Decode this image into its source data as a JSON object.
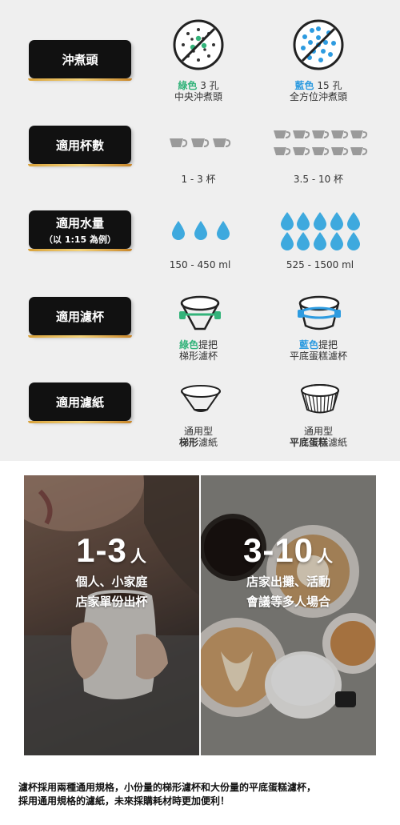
{
  "rows": {
    "brew_head": {
      "label": "沖煮頭",
      "left": {
        "color_word": "綠色",
        "count_text": " 3 孔",
        "desc": "中央沖煮頭"
      },
      "right": {
        "color_word": "藍色",
        "count_text": " 15 孔",
        "desc": "全方位沖煮頭"
      }
    },
    "cups": {
      "label": "適用杯數",
      "left": {
        "range": "1 - 3 杯",
        "cup_count": 3
      },
      "right": {
        "range": "3.5 - 10 杯",
        "cup_count": 10
      }
    },
    "water": {
      "label": "適用水量",
      "label_sub": "（以 1:15 為例）",
      "left": {
        "range": "150 - 450 ml",
        "drop_count": 3
      },
      "right": {
        "range": "525 - 1500 ml",
        "drop_count": 10
      }
    },
    "dripper": {
      "label": "適用濾杯",
      "left": {
        "color_word": "綠色",
        "suffix": "提把",
        "desc": "梯形濾杯"
      },
      "right": {
        "color_word": "藍色",
        "suffix": "提把",
        "desc": "平底蛋糕濾杯"
      }
    },
    "paper": {
      "label": "適用濾紙",
      "left": {
        "line1": "通用型",
        "bold": "梯形",
        "suffix": "濾紙"
      },
      "right": {
        "line1": "通用型",
        "bold": "平底蛋糕",
        "suffix": "濾紙"
      }
    }
  },
  "photos": {
    "left": {
      "big": "1-3",
      "unit": "人",
      "line1": "個人、小家庭",
      "line2": "店家單份出杯"
    },
    "right": {
      "big": "3-10",
      "unit": "人",
      "line1": "店家出攤、活動",
      "line2": "會議等多人場合"
    }
  },
  "note": {
    "line1": "濾杯採用兩種通用規格，小份量的梯形濾杯和大份量的平底蛋糕濾杯，",
    "line2": "採用通用規格的濾紙，未來採購耗材時更加便利！"
  },
  "colors": {
    "green": "#33b37a",
    "blue": "#2d9be0",
    "drop": "#3ea9de",
    "cup": "#9a9a9a",
    "gold": "#e0b04a"
  }
}
